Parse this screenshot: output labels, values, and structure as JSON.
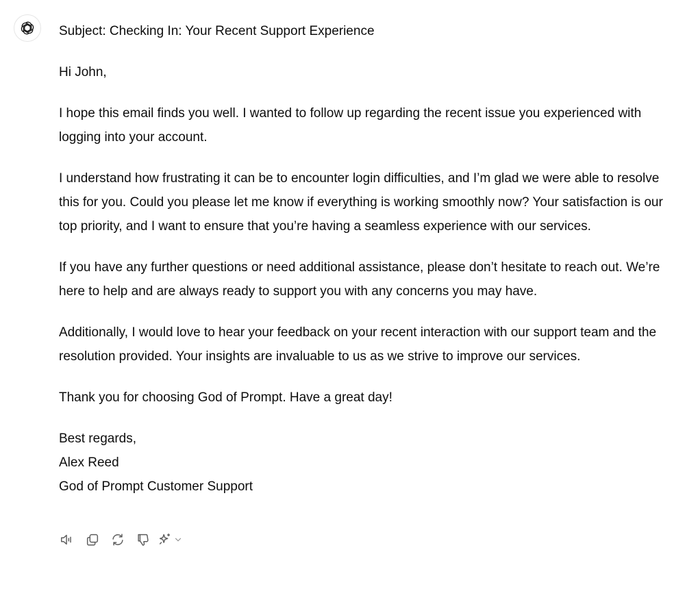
{
  "email": {
    "subject": "Subject: Checking In: Your Recent Support Experience",
    "greeting": "Hi John,",
    "paragraphs": [
      "I hope this email finds you well. I wanted to follow up regarding the recent issue you experienced with logging into your account.",
      "I understand how frustrating it can be to encounter login difficulties, and I’m glad we were able to resolve this for you. Could you please let me know if everything is working smoothly now? Your satisfaction is our top priority, and I want to ensure that you’re having a seamless experience with our services.",
      "If you have any further questions or need additional assistance, please don’t hesitate to reach out. We’re here to help and are always ready to support you with any concerns you may have.",
      "Additionally, I would love to hear your feedback on your recent interaction with our support team and the resolution provided. Your insights are invaluable to us as we strive to improve our services.",
      "Thank you for choosing God of Prompt. Have a great day!"
    ],
    "signoff": {
      "closing": "Best regards,",
      "name": "Alex Reed",
      "team": "God of Prompt Customer Support"
    }
  },
  "avatar": {
    "icon": "openai-logo-icon"
  },
  "actions": [
    {
      "name": "read-aloud-button",
      "icon": "speaker-icon"
    },
    {
      "name": "copy-button",
      "icon": "copy-icon"
    },
    {
      "name": "regenerate-button",
      "icon": "refresh-icon"
    },
    {
      "name": "thumbs-down-button",
      "icon": "thumbs-down-icon"
    },
    {
      "name": "model-switch-button",
      "icon": "sparkle-icon"
    }
  ],
  "colors": {
    "text": "#0d0d0d",
    "icon": "#5d5d5d",
    "avatar_border": "#e5e5e5"
  }
}
